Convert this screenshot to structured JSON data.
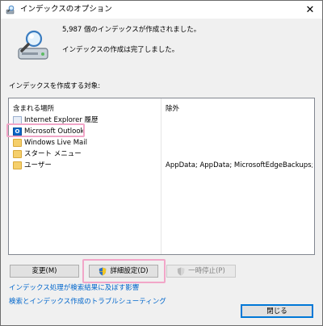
{
  "window": {
    "title": "インデックスのオプション",
    "close_glyph": "✕"
  },
  "status": {
    "count_line": "5,987 個のインデックスが作成されました。",
    "state_line": "インデックスの作成は完了しました。"
  },
  "locations": {
    "section_label": "インデックスを作成する対象:",
    "columns": {
      "included": "含まれる場所",
      "excluded": "除外"
    },
    "rows": [
      {
        "name": "Internet Explorer 履歴",
        "exclude": "",
        "icon": "ie-history-icon"
      },
      {
        "name": "Microsoft Outlook",
        "exclude": "",
        "icon": "outlook-icon"
      },
      {
        "name": "Windows Live Mail",
        "exclude": "",
        "icon": "folder-icon"
      },
      {
        "name": "スタート メニュー",
        "exclude": "",
        "icon": "folder-icon"
      },
      {
        "name": "ユーザー",
        "exclude": "AppData; AppData; MicrosoftEdgeBackups; A...",
        "icon": "folder-icon"
      }
    ]
  },
  "buttons": {
    "modify": "変更(M)",
    "advanced": "詳細設定(D)",
    "pause": "一時停止(P)",
    "close": "閉じる"
  },
  "links": {
    "affects_search": "インデックス処理が検索結果に及ぼす影響",
    "troubleshoot": "検索とインデックス作成のトラブルシューティング"
  },
  "colors": {
    "highlight": "#f2a6c8",
    "link": "#0066cc",
    "accent": "#0078d7"
  }
}
